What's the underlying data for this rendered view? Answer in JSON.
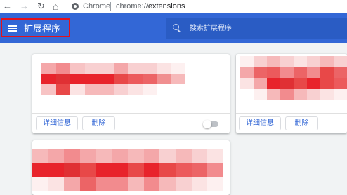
{
  "browser": {
    "back_icon": "←",
    "forward_icon": "→",
    "reload_icon": "↻",
    "home_icon": "⌂",
    "site_label": "Chrome",
    "url_scheme": "chrome://",
    "url_path": "extensions"
  },
  "header": {
    "title": "扩展程序",
    "search_placeholder": "搜索扩展程序",
    "highlight_color": "#e3111c",
    "bar_color": "#3367d6"
  },
  "extensions": [
    {
      "details_label": "详细信息",
      "remove_label": "删除",
      "enabled": false
    },
    {
      "details_label": "详细信息",
      "remove_label": "删除"
    },
    {}
  ],
  "redaction_color": "#e8232b"
}
